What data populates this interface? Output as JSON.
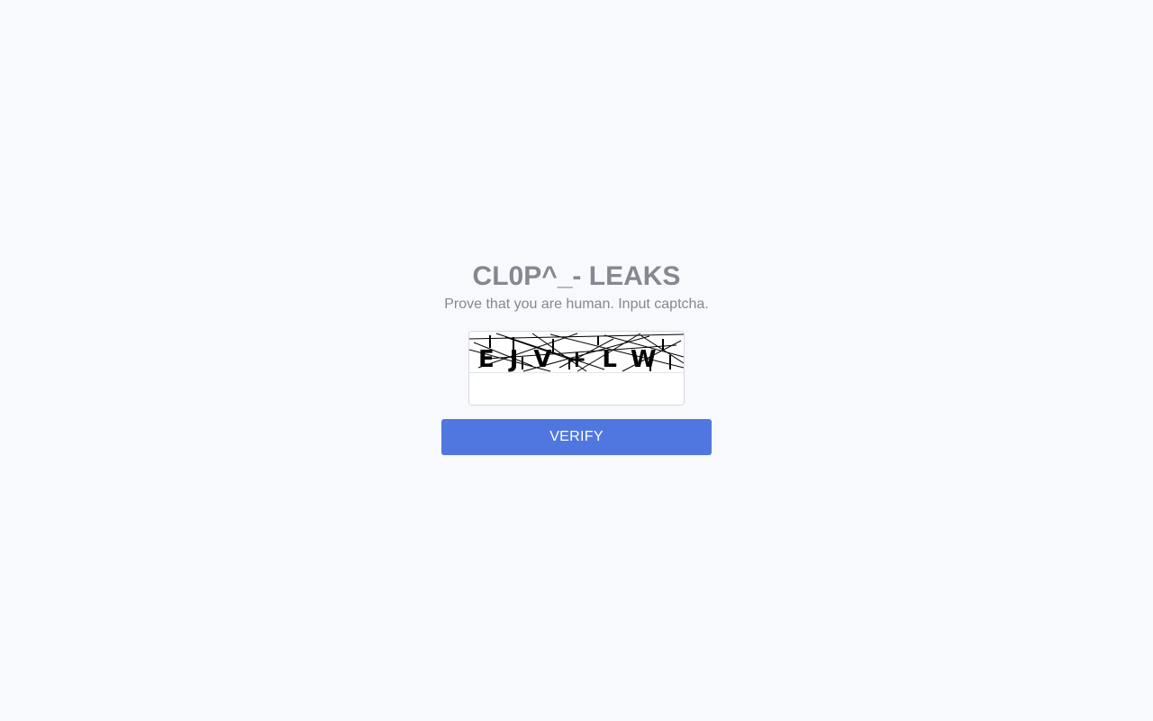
{
  "header": {
    "title": "CL0P^_- LEAKS",
    "subtitle": "Prove that you are human. Input captcha."
  },
  "captcha": {
    "image_text": "EJV+LW",
    "input_value": "",
    "input_placeholder": ""
  },
  "actions": {
    "verify_label": "VERIFY"
  },
  "colors": {
    "background": "#f7f9fc",
    "text_muted": "#868791",
    "accent": "#5077e0"
  }
}
